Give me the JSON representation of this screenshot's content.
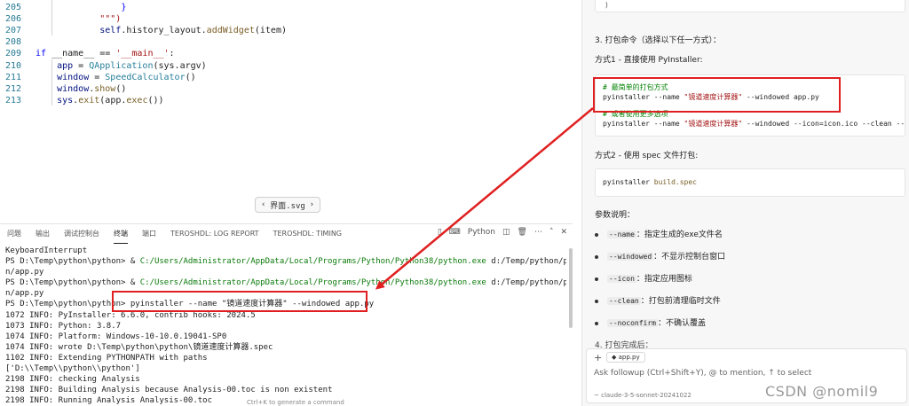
{
  "editor": {
    "lines": [
      {
        "num": "205",
        "indent": "                ",
        "parts": [
          {
            "t": "}",
            "c": "kw"
          }
        ]
      },
      {
        "num": "206",
        "indent": "            ",
        "parts": [
          {
            "t": "\"\"\")",
            "c": "str"
          }
        ]
      },
      {
        "num": "207",
        "indent": "            ",
        "parts": [
          {
            "t": "self",
            "c": "var"
          },
          {
            "t": ".history_layout.",
            "c": "plain"
          },
          {
            "t": "addWidget",
            "c": "fn"
          },
          {
            "t": "(item)",
            "c": "plain"
          }
        ]
      },
      {
        "num": "208",
        "indent": "",
        "parts": []
      },
      {
        "num": "209",
        "indent": "",
        "parts": [
          {
            "t": "if",
            "c": "kw"
          },
          {
            "t": " __name__ == ",
            "c": "plain"
          },
          {
            "t": "'__main__'",
            "c": "str"
          },
          {
            "t": ":",
            "c": "plain"
          }
        ]
      },
      {
        "num": "210",
        "indent": "    ",
        "parts": [
          {
            "t": "app",
            "c": "var"
          },
          {
            "t": " = ",
            "c": "plain"
          },
          {
            "t": "QApplication",
            "c": "cls"
          },
          {
            "t": "(sys.argv)",
            "c": "plain"
          }
        ]
      },
      {
        "num": "211",
        "indent": "    ",
        "parts": [
          {
            "t": "window",
            "c": "var"
          },
          {
            "t": " = ",
            "c": "plain"
          },
          {
            "t": "SpeedCalculator",
            "c": "cls"
          },
          {
            "t": "()",
            "c": "plain"
          }
        ]
      },
      {
        "num": "212",
        "indent": "    ",
        "parts": [
          {
            "t": "window",
            "c": "var"
          },
          {
            "t": ".",
            "c": "plain"
          },
          {
            "t": "show",
            "c": "fn"
          },
          {
            "t": "()",
            "c": "plain"
          }
        ]
      },
      {
        "num": "213",
        "indent": "    ",
        "parts": [
          {
            "t": "sys",
            "c": "var"
          },
          {
            "t": ".",
            "c": "plain"
          },
          {
            "t": "exit",
            "c": "fn"
          },
          {
            "t": "(app.",
            "c": "plain"
          },
          {
            "t": "exec",
            "c": "fn"
          },
          {
            "t": "())",
            "c": "plain"
          }
        ]
      }
    ],
    "file_chip": "界面.svg"
  },
  "panel": {
    "tabs": [
      "问题",
      "输出",
      "调试控制台",
      "终端",
      "端口",
      "TEROSHDL: LOG REPORT",
      "TEROSHDL: TIMING"
    ],
    "active_tab": "终端",
    "shell_label": "Python",
    "lines": [
      "KeyboardInterrupt",
      "PS D:\\Temp\\python\\python> & C:/Users/Administrator/AppData/Local/Programs/Python/Python38/python.exe d:/Temp/python/pytho",
      "n/app.py",
      "PS D:\\Temp\\python\\python> & C:/Users/Administrator/AppData/Local/Programs/Python/Python38/python.exe d:/Temp/python/pytho",
      "n/app.py",
      "PS D:\\Temp\\python\\python> pyinstaller --name \"镜道速度计算器\" --windowed app.py",
      "1072 INFO: PyInstaller: 6.6.0, contrib hooks: 2024.5",
      "1073 INFO: Python: 3.8.7",
      "1074 INFO: Platform: Windows-10-10.0.19041-SP0",
      "1074 INFO: wrote D:\\Temp\\python\\python\\镜道速度计算器.spec",
      "1102 INFO: Extending PYTHONPATH with paths",
      "['D:\\\\Temp\\\\python\\\\python']",
      "2198 INFO: checking Analysis",
      "2198 INFO: Building Analysis because Analysis-00.toc is non existent",
      "2198 INFO: Running Analysis Analysis-00.toc"
    ],
    "hint": "Ctrl+K to generate a command"
  },
  "chat": {
    "top_brace": ")",
    "step3_title": "3. 打包命令（选择以下任一方式）：",
    "method1_title": "方式1 - 直接使用 PyInstaller:",
    "code1": {
      "comment1": "# 最简单的打包方式",
      "cmd1_a": "pyinstaller --name ",
      "cmd1_str": "\"镜道速度计算器\"",
      "cmd1_b": " --windowed app.py",
      "comment2": "# 或者使用更多选项",
      "cmd2_a": "pyinstaller --name ",
      "cmd2_str": "\"镜道速度计算器\"",
      "cmd2_b": " --windowed --icon=icon.ico --clean --noconf"
    },
    "method2_title": "方式2 - 使用 spec 文件打包:",
    "code2": {
      "cmd": "pyinstaller ",
      "arg": "build.spec"
    },
    "params_title": "参数说明：",
    "params": [
      {
        "flag": "--name",
        "desc": "：指定生成的exe文件名"
      },
      {
        "flag": "--windowed",
        "desc": "：不显示控制台窗口"
      },
      {
        "flag": "--icon",
        "desc": "：指定应用图标"
      },
      {
        "flag": "--clean",
        "desc": "：打包前清理临时文件"
      },
      {
        "flag": "--noconfirm",
        "desc": "：不确认覆盖"
      }
    ],
    "step4_title": "4. 打包完成后：",
    "followup": {
      "file": "app.py",
      "placeholder": "Ask followup (Ctrl+Shift+Y), @ to mention, ↑ to select",
      "model": "~ claude-3-5-sonnet-20241022"
    }
  },
  "watermark": "CSDN @nomil9",
  "colors": {
    "annotation": "#e02020"
  }
}
